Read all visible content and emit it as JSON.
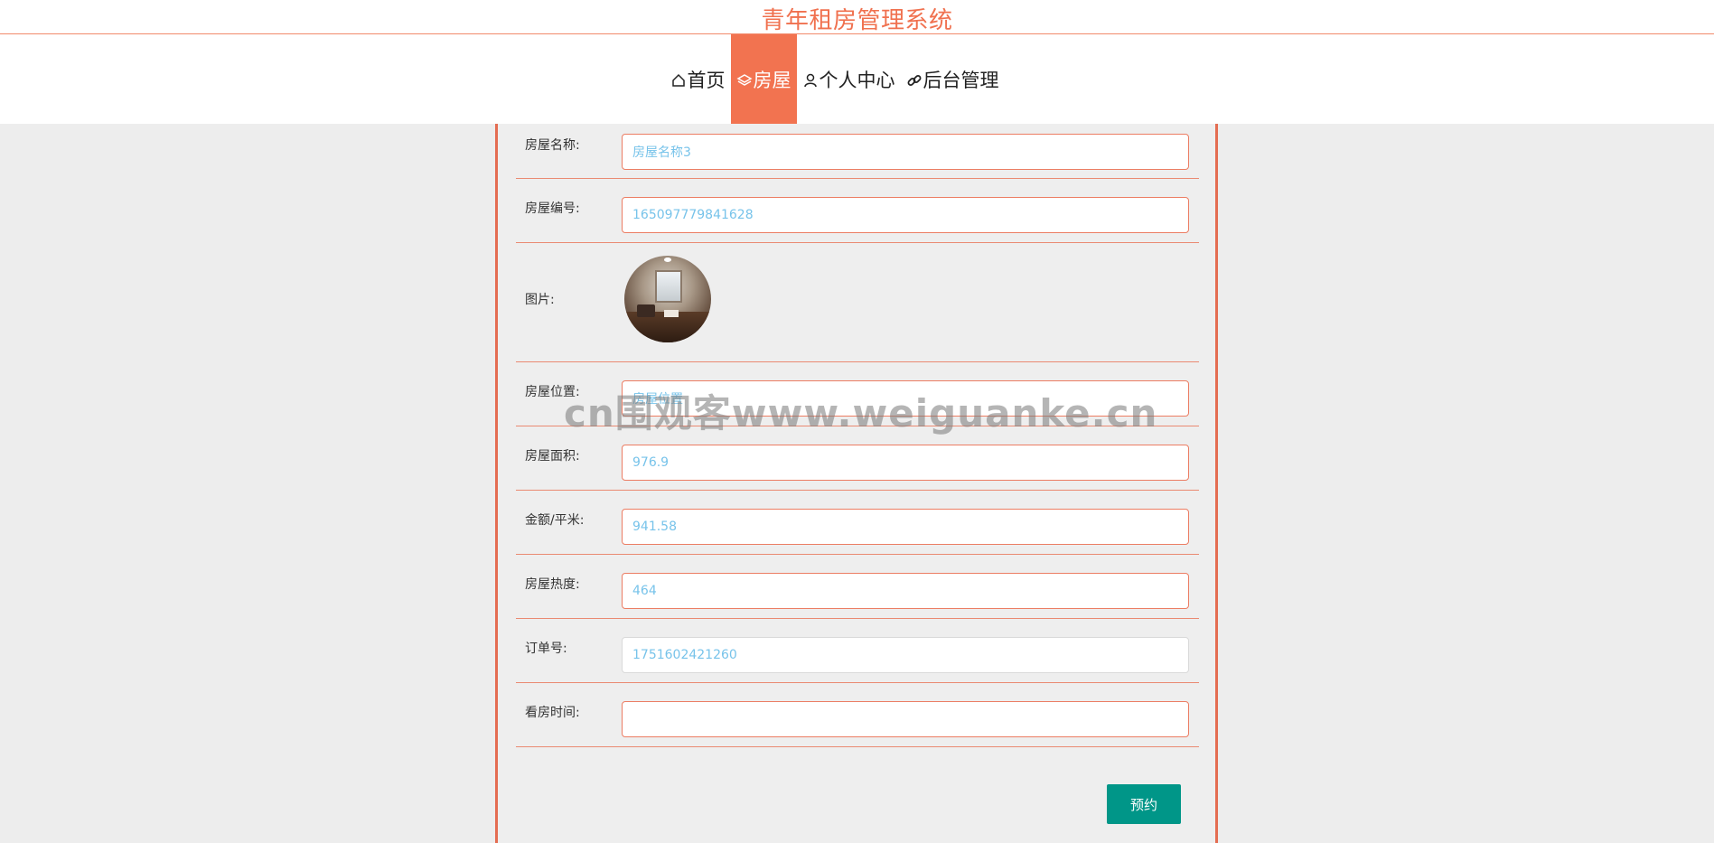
{
  "site": {
    "title": "青年租房管理系统"
  },
  "nav": {
    "items": [
      {
        "label": "首页",
        "icon": "home-icon",
        "active": false
      },
      {
        "label": "房屋",
        "icon": "layers-icon",
        "active": true
      },
      {
        "label": "个人中心",
        "icon": "user-icon",
        "active": false
      },
      {
        "label": "后台管理",
        "icon": "link-icon",
        "active": false
      }
    ]
  },
  "form": {
    "house_name": {
      "label": "房屋名称:",
      "value": "房屋名称3"
    },
    "house_no": {
      "label": "房屋编号:",
      "value": "165097779841628"
    },
    "picture": {
      "label": "图片:"
    },
    "location": {
      "label": "房屋位置:",
      "value": "房屋位置"
    },
    "area": {
      "label": "房屋面积:",
      "value": "976.9"
    },
    "price_per_sqm": {
      "label": "金额/平米:",
      "value": "941.58"
    },
    "heat": {
      "label": "房屋热度:",
      "value": "464"
    },
    "order_no": {
      "label": "订单号:",
      "value": "1751602421260"
    },
    "viewing_time": {
      "label": "看房时间:",
      "value": ""
    },
    "submit_label": "预约"
  },
  "watermark": {
    "text": "cn围观客www.weiguanke.cn"
  },
  "colors": {
    "accent": "#f27350",
    "title": "#f0714f",
    "button": "#009688",
    "value_text": "#77c3ea"
  }
}
